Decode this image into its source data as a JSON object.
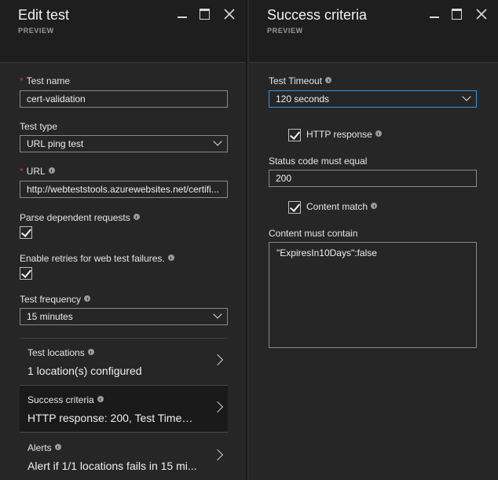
{
  "left_blade": {
    "title": "Edit test",
    "subtitle": "PREVIEW",
    "fields": {
      "test_name": {
        "label": "Test name",
        "required": "*",
        "value": "cert-validation"
      },
      "test_type": {
        "label": "Test type",
        "value": "URL ping test"
      },
      "url": {
        "label": "URL",
        "required": "*",
        "value": "http://webteststools.azurewebsites.net/certifi..."
      },
      "parse_dependent": {
        "label": "Parse dependent requests",
        "checked": true
      },
      "enable_retries": {
        "label": "Enable retries for web test failures.",
        "checked": true
      },
      "test_frequency": {
        "label": "Test frequency",
        "value": "15 minutes"
      }
    },
    "nav": [
      {
        "title": "Test locations",
        "value": "1 location(s) configured"
      },
      {
        "title": "Success criteria",
        "value": "HTTP response: 200, Test Timeout..."
      },
      {
        "title": "Alerts",
        "value": "Alert if 1/1 locations fails in 15 mi..."
      }
    ]
  },
  "right_blade": {
    "title": "Success criteria",
    "subtitle": "PREVIEW",
    "test_timeout": {
      "label": "Test Timeout",
      "value": "120 seconds"
    },
    "http_response": {
      "label": "HTTP response",
      "checked": true
    },
    "status_code": {
      "label": "Status code must equal",
      "value": "200"
    },
    "content_match": {
      "label": "Content match",
      "checked": true
    },
    "content_contain": {
      "label": "Content must contain",
      "value": "\"ExpiresIn10Days\":false"
    }
  },
  "colors": {
    "background": "#262626",
    "header": "#1e1e1e",
    "required": "#e0322b",
    "focus_border": "#3a96dd",
    "selected_item": "#1a1a1a"
  },
  "icons": [
    "minimize-icon",
    "maximize-icon",
    "close-icon",
    "info-icon",
    "chevron-down-icon",
    "chevron-right-icon",
    "checkmark-icon"
  ]
}
